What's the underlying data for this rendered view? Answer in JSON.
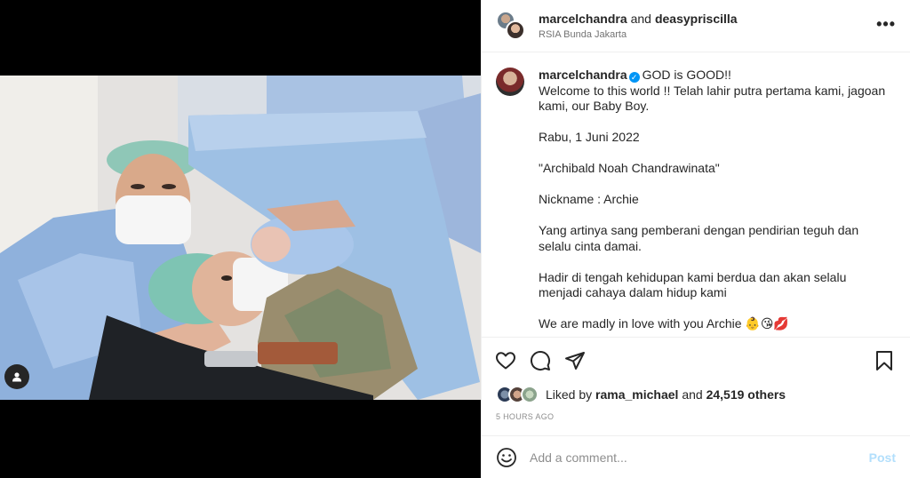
{
  "header": {
    "user1": "marcelchandra",
    "conj": "and",
    "user2": "deasypriscilla",
    "location": "RSIA Bunda Jakarta",
    "more_label": "•••"
  },
  "caption": {
    "username": "marcelchandra",
    "verified_mark": "✓",
    "lines": [
      "GOD is GOOD!!",
      "Welcome to this world !! Telah lahir putra pertama kami, jagoan kami, our Baby Boy.",
      "Rabu, 1 Juni 2022",
      "\"Archibald Noah Chandrawinata\"",
      "Nickname : Archie",
      "Yang artinya sang pemberani dengan pendirian teguh dan selalu cinta damai.",
      "Hadir di tengah kehidupan kami berdua dan akan selalu menjadi cahaya dalam hidup kami",
      "We are madly in love with you Archie",
      "👶😘💋"
    ]
  },
  "likes": {
    "prefix": "Liked by",
    "user": "rama_michael",
    "and": "and",
    "count": "24,519 others"
  },
  "time": "5 HOURS AGO",
  "comment": {
    "placeholder": "Add a comment...",
    "post_label": "Post"
  },
  "icons": {
    "like": "heart-icon",
    "comment": "comment-icon",
    "share": "share-icon",
    "save": "bookmark-icon",
    "emoji": "smiley-icon",
    "tagged": "user-tag-icon"
  },
  "colors": {
    "link_blue": "#0095f6",
    "post_disabled": "#b2dffc",
    "text": "#262626",
    "muted": "#8e8e8e"
  }
}
